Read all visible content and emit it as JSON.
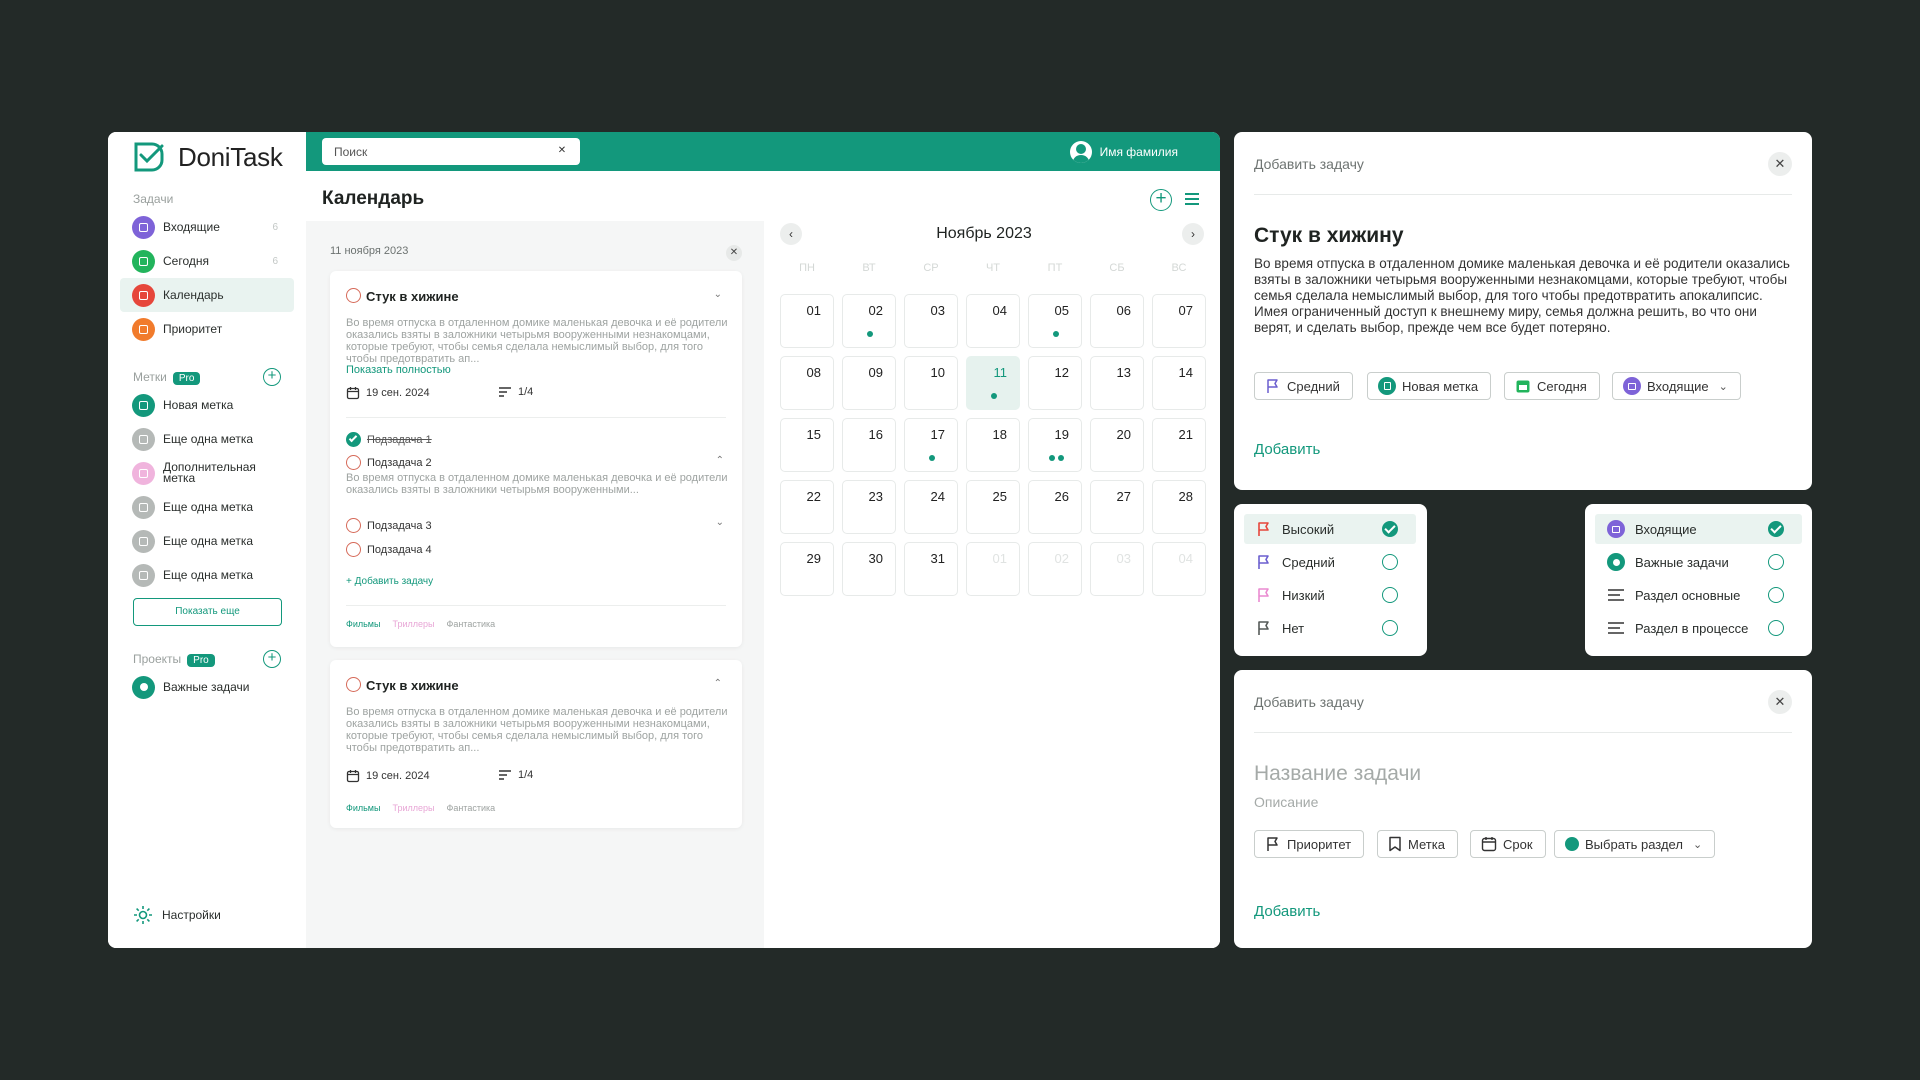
{
  "app": {
    "logo_text": "DoniTask",
    "search_placeholder": "Поиск",
    "user_name": "Имя фамилия",
    "page_title": "Календарь",
    "accent": "#13987c"
  },
  "sidebar": {
    "tasks_label": "Задачи",
    "items": [
      {
        "label": "Входящие",
        "count": "6",
        "color": "#7e63d8"
      },
      {
        "label": "Сегодня",
        "count": "6",
        "color": "#22b45c"
      },
      {
        "label": "Календарь",
        "count": "",
        "color": "#e6463b"
      },
      {
        "label": "Приоритет",
        "count": "",
        "color": "#f17b2c"
      }
    ],
    "labels_label": "Метки",
    "pro": "Pro",
    "labels": [
      {
        "label": "Новая метка",
        "color": "#13987c"
      },
      {
        "label": "Еще одна метка",
        "color": "#b5b9b7"
      },
      {
        "label": "Дополнительная метка",
        "color": "#f0b4dd"
      },
      {
        "label": "Еще одна метка",
        "color": "#b5b9b7"
      },
      {
        "label": "Еще одна метка",
        "color": "#b5b9b7"
      },
      {
        "label": "Еще одна метка",
        "color": "#b5b9b7"
      }
    ],
    "show_more": "Показать еще",
    "projects_label": "Проекты",
    "projects": [
      {
        "label": "Важные задачи",
        "color": "#13987c"
      }
    ],
    "settings": "Настройки"
  },
  "tasks_panel": {
    "date": "11 ноября 2023",
    "card1": {
      "title": "Стук в хижине",
      "desc": "Во время отпуска в отдаленном домике маленькая девочка и её родители оказались взяты в заложники четырьмя вооруженными незнакомцами, которые требуют, чтобы семья сделала немыслимый выбор, для того чтобы предотвратить ап...",
      "show_full": "Показать полностью",
      "due": "19 сен. 2024",
      "progress": "1/4",
      "subtasks": [
        {
          "label": "Подзадача 1",
          "done": true
        },
        {
          "label": "Подзадача 2",
          "done": false
        },
        {
          "label": "Подзадача 3",
          "done": false
        },
        {
          "label": "Подзадача 4",
          "done": false
        }
      ],
      "sub_desc": "Во время отпуска в отдаленном домике маленькая девочка и её родители оказались взяты в заложники четырьмя вооруженными...",
      "add_task": "Добавить задачу",
      "tags": [
        "Фильмы",
        "Триллеры",
        "Фантастика"
      ]
    },
    "card2": {
      "title": "Стук в хижине",
      "desc": "Во время отпуска в отдаленном домике маленькая девочка и её родители оказались взяты в заложники четырьмя вооруженными незнакомцами, которые требуют, чтобы семья сделала немыслимый выбор, для того чтобы предотвратить ап...",
      "due": "19 сен. 2024",
      "progress": "1/4",
      "tags": [
        "Фильмы",
        "Триллеры",
        "Фантастика"
      ]
    }
  },
  "calendar": {
    "month": "Ноябрь 2023",
    "dow": [
      "ПН",
      "ВТ",
      "СР",
      "ЧТ",
      "ПТ",
      "СБ",
      "ВС"
    ],
    "days": [
      {
        "d": "01"
      },
      {
        "d": "02",
        "dots": 1
      },
      {
        "d": "03"
      },
      {
        "d": "04"
      },
      {
        "d": "05",
        "dots": 1
      },
      {
        "d": "06"
      },
      {
        "d": "07"
      },
      {
        "d": "08"
      },
      {
        "d": "09"
      },
      {
        "d": "10"
      },
      {
        "d": "11",
        "dots": 1,
        "today": true
      },
      {
        "d": "12"
      },
      {
        "d": "13"
      },
      {
        "d": "14"
      },
      {
        "d": "15"
      },
      {
        "d": "16"
      },
      {
        "d": "17",
        "dots": 1
      },
      {
        "d": "18"
      },
      {
        "d": "19",
        "dots": 2
      },
      {
        "d": "20"
      },
      {
        "d": "21"
      },
      {
        "d": "22"
      },
      {
        "d": "23"
      },
      {
        "d": "24"
      },
      {
        "d": "25"
      },
      {
        "d": "26"
      },
      {
        "d": "27"
      },
      {
        "d": "28"
      },
      {
        "d": "29"
      },
      {
        "d": "30"
      },
      {
        "d": "31"
      },
      {
        "d": "01",
        "muted": true
      },
      {
        "d": "02",
        "muted": true
      },
      {
        "d": "03",
        "muted": true
      },
      {
        "d": "04",
        "muted": true
      }
    ]
  },
  "add_task_filled": {
    "header": "Добавить задачу",
    "title": "Стук в хижину",
    "desc": "Во время отпуска в отдаленном домике маленькая девочка и её родители оказались взяты в заложники четырьмя вооруженными незнакомцами, которые требуют, чтобы семья сделала немыслимый выбор, для того чтобы предотвратить апокалипсис. Имея ограниченный доступ к внешнему миру, семья должна решить, во что они верят, и сделать выбор, прежде чем все будет потеряно.",
    "chips": [
      "Средний",
      "Новая метка",
      "Сегодня",
      "Входящие"
    ],
    "add": "Добавить"
  },
  "priority_menu": {
    "items": [
      {
        "label": "Высокий",
        "color": "#e6463b",
        "selected": true
      },
      {
        "label": "Средний",
        "color": "#6b5fcf",
        "selected": false
      },
      {
        "label": "Низкий",
        "color": "#ea8ad0",
        "selected": false
      },
      {
        "label": "Нет",
        "color": "#555a58",
        "selected": false
      }
    ]
  },
  "section_menu": {
    "items": [
      {
        "label": "Входящие",
        "selected": true
      },
      {
        "label": "Важные задачи",
        "selected": false
      },
      {
        "label": "Раздел основные",
        "selected": false
      },
      {
        "label": "Раздел в процессе",
        "selected": false
      }
    ]
  },
  "add_task_empty": {
    "header": "Добавить задачу",
    "title_placeholder": "Название задачи",
    "desc_placeholder": "Описание",
    "chips": [
      "Приоритет",
      "Метка",
      "Срок",
      "Выбрать раздел"
    ],
    "add": "Добавить"
  }
}
